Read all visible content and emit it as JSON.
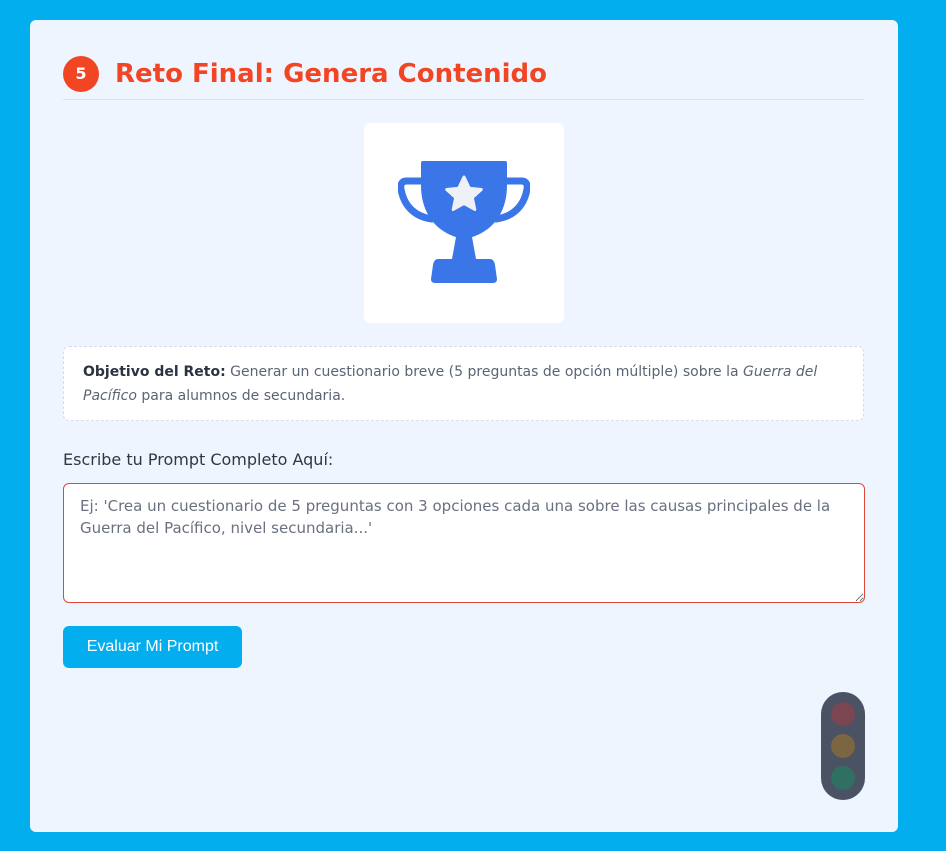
{
  "header": {
    "step_number": "5",
    "title": "Reto Final: Genera Contenido"
  },
  "hero": {
    "icon": "trophy-star-icon",
    "icon_color": "#3a76e8"
  },
  "objective": {
    "label": "Objetivo del Reto:",
    "text_before": " Generar un cuestionario breve (5 preguntas de opción múltiple) sobre la ",
    "emphasis": "Guerra del Pacífico",
    "text_after": " para alumnos de secundaria."
  },
  "prompt": {
    "label": "Escribe tu Prompt Completo Aquí:",
    "value": "",
    "placeholder": "Ej: 'Crea un cuestionario de 5 preguntas con 3 opciones cada una sobre las causas principales de la Guerra del Pacífico, nivel secundaria...'"
  },
  "actions": {
    "evaluate_label": "Evaluar Mi Prompt"
  },
  "status": {
    "icon": "traffic-light-icon",
    "lights": [
      "red",
      "yellow",
      "green"
    ],
    "active": "none"
  },
  "colors": {
    "page_background": "#03aeef",
    "accent": "#f24524",
    "primary_button": "#03aeef",
    "card_background": "#eef5ff"
  }
}
